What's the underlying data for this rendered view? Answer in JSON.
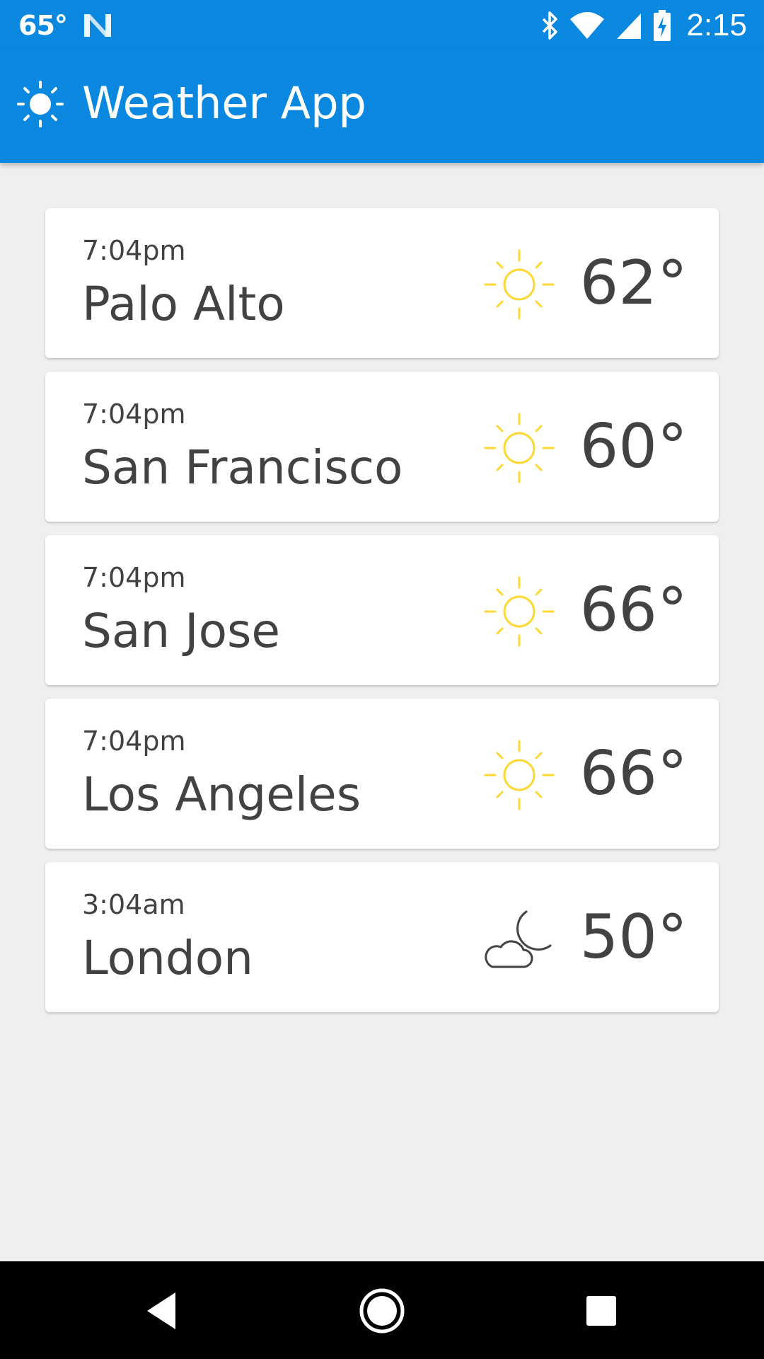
{
  "status_bar": {
    "temperature": "65°",
    "notification_icon": "n-logo-icon",
    "icons": [
      "bluetooth-icon",
      "wifi-icon",
      "cell-signal-icon",
      "battery-charging-icon"
    ],
    "time": "2:15"
  },
  "app_bar": {
    "icon": "sun-icon",
    "title": "Weather App",
    "background_color": "#0a88e0"
  },
  "cities": [
    {
      "time": "7:04pm",
      "name": "Palo Alto",
      "condition_icon": "sun-icon",
      "temperature": "62°"
    },
    {
      "time": "7:04pm",
      "name": "San Francisco",
      "condition_icon": "sun-icon",
      "temperature": "60°"
    },
    {
      "time": "7:04pm",
      "name": "San Jose",
      "condition_icon": "sun-icon",
      "temperature": "66°"
    },
    {
      "time": "7:04pm",
      "name": "Los Angeles",
      "condition_icon": "sun-icon",
      "temperature": "66°"
    },
    {
      "time": "3:04am",
      "name": "London",
      "condition_icon": "cloudy-night-icon",
      "temperature": "50°"
    }
  ],
  "colors": {
    "sun": "#fdd835",
    "text": "#424242",
    "background": "#efefef"
  },
  "nav_bar": {
    "buttons": [
      "back-icon",
      "home-icon",
      "recents-icon"
    ]
  }
}
